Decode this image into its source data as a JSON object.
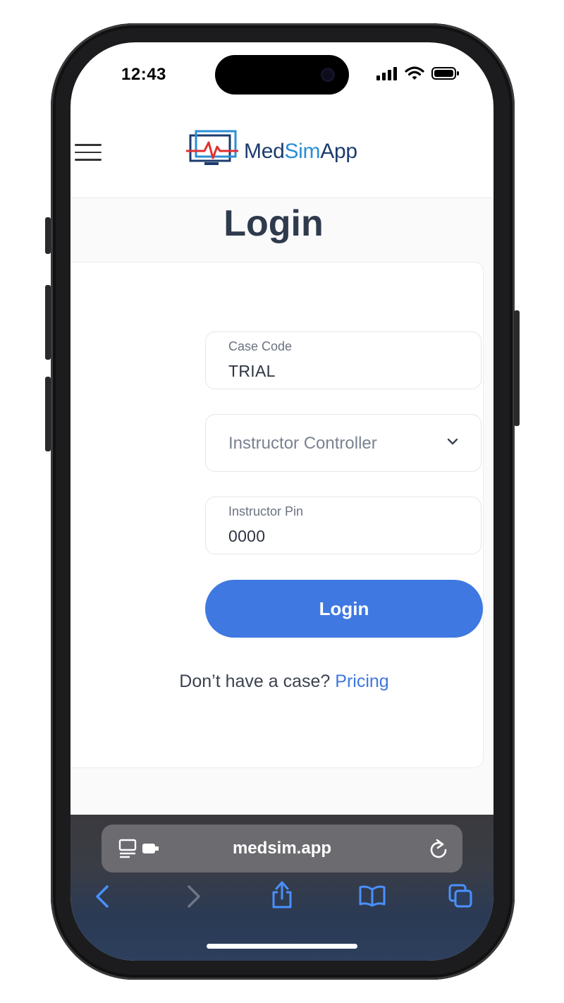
{
  "status_bar": {
    "time": "12:43",
    "icons": [
      "signal-icon",
      "wifi-icon",
      "battery-icon"
    ]
  },
  "header": {
    "menu_icon": "hamburger-menu-icon",
    "logo": {
      "icon": "monitor-heartbeat-logo-icon",
      "text_part1": "Med",
      "text_part2": "Sim",
      "text_part3": "App"
    }
  },
  "page": {
    "title": "Login"
  },
  "form": {
    "case_code": {
      "label": "Case Code",
      "value": "TRIAL"
    },
    "role_select": {
      "selected": "Instructor Controller"
    },
    "instructor_pin": {
      "label": "Instructor Pin",
      "value": "0000"
    },
    "submit_label": "Login",
    "signup_prompt": "Don’t have a case?",
    "signup_link": "Pricing"
  },
  "browser": {
    "url": "medsim.app",
    "toolbar": [
      "back-icon",
      "forward-icon",
      "share-icon",
      "bookmarks-icon",
      "tabs-icon"
    ]
  },
  "colors": {
    "accent": "#3f78e0",
    "logo_navy": "#1d3b6e",
    "logo_blue": "#2b8fd6",
    "logo_red": "#e03131",
    "title": "#2f3a4d"
  }
}
